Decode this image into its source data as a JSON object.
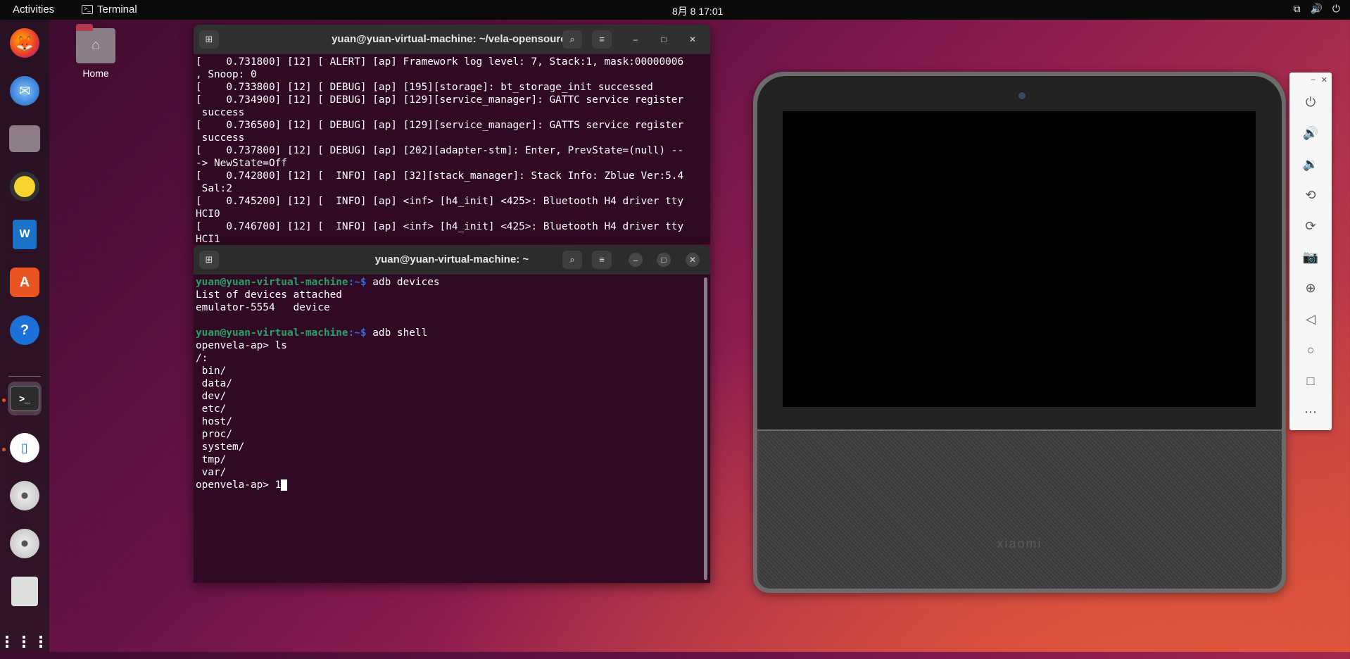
{
  "topbar": {
    "activities": "Activities",
    "app_name": "Terminal",
    "clock": "8月 8  17:01"
  },
  "desktop": {
    "home_label": "Home"
  },
  "dock": {
    "apps": [
      "firefox-icon",
      "thunderbird-icon",
      "files-icon",
      "rhythmbox-icon",
      "writer-icon",
      "software-icon",
      "help-icon",
      "terminal-icon",
      "emulator-icon",
      "disc-icon",
      "disc-icon-2",
      "text-editor-icon",
      "show-apps-icon"
    ]
  },
  "term_back": {
    "title": "yuan@yuan-virtual-machine: ~/vela-opensource",
    "lines": [
      "[    0.731800] [12] [ ALERT] [ap] Framework log level: 7, Stack:1, mask:00000006",
      ", Snoop: 0",
      "[    0.733800] [12] [ DEBUG] [ap] [195][storage]: bt_storage_init successed",
      "[    0.734900] [12] [ DEBUG] [ap] [129][service_manager]: GATTC service register",
      " success",
      "[    0.736500] [12] [ DEBUG] [ap] [129][service_manager]: GATTS service register",
      " success",
      "[    0.737800] [12] [ DEBUG] [ap] [202][adapter-stm]: Enter, PrevState=(null) --",
      "-> NewState=Off",
      "[    0.742800] [12] [  INFO] [ap] [32][stack_manager]: Stack Info: Zblue Ver:5.4",
      " Sal:2",
      "[    0.745200] [12] [  INFO] [ap] <inf> [h4_init] <425>: Bluetooth H4 driver tty",
      "HCI0",
      "[    0.746700] [12] [  INFO] [ap] <inf> [h4_init] <425>: Bluetooth H4 driver tty",
      "HCI1"
    ]
  },
  "term_front": {
    "title": "yuan@yuan-virtual-machine: ~",
    "prompt_user": "yuan@yuan-virtual-machine",
    "prompt_path": ":~$ ",
    "cmd1": "adb devices",
    "out1": "List of devices attached",
    "out2": "emulator-5554   device",
    "cmd2": "adb shell",
    "vela_prompt": "openvela-ap> ",
    "cmd3": "ls",
    "ls_lines": [
      "/:",
      " bin/",
      " data/",
      " dev/",
      " etc/",
      " host/",
      " proc/",
      " system/",
      " tmp/",
      " var/"
    ],
    "current_input": "1"
  },
  "device": {
    "brand": "xiaomi"
  }
}
